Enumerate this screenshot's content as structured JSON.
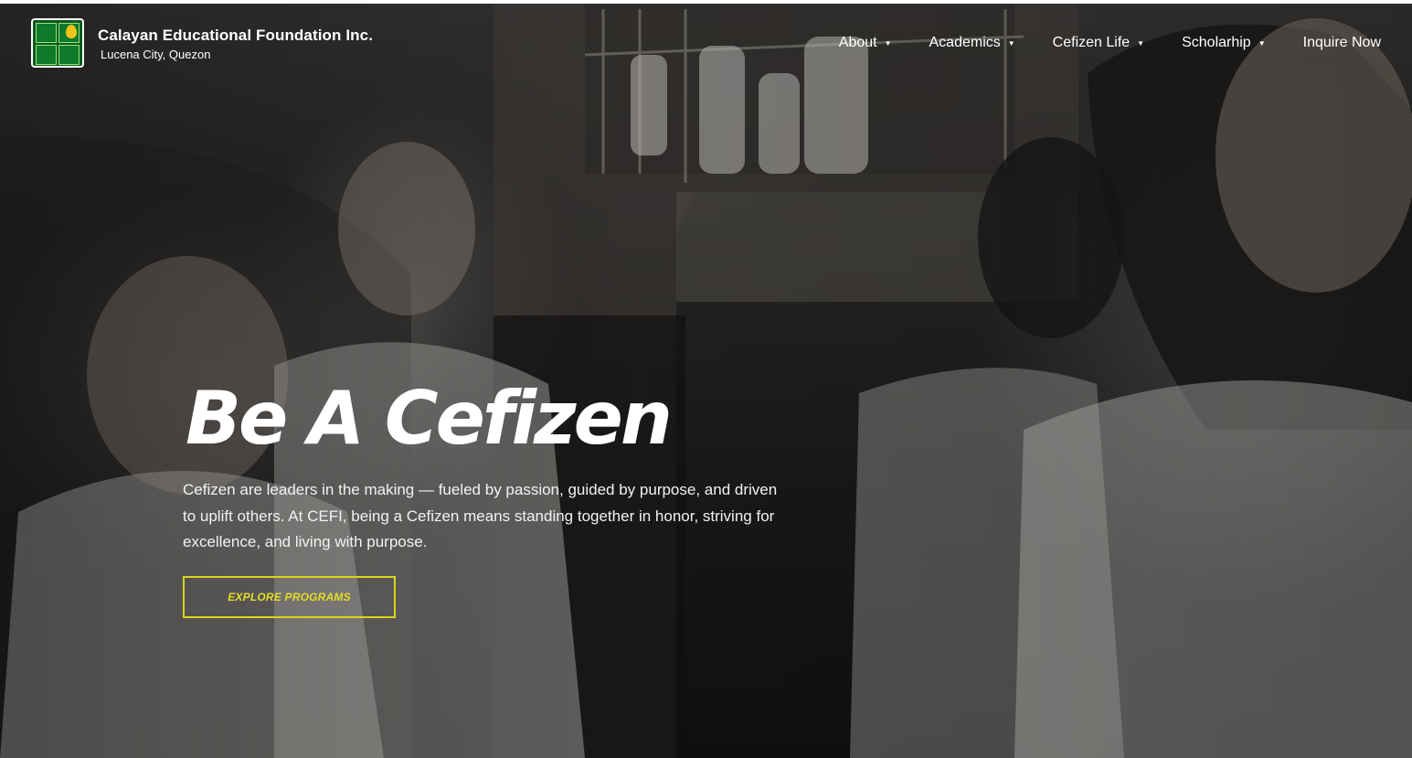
{
  "brand": {
    "name": "Calayan Educational Foundation Inc.",
    "location": "Lucena City, Quezon",
    "logo_icon": "cefi-logo-icon"
  },
  "nav": {
    "items": [
      {
        "label": "About",
        "has_dropdown": true
      },
      {
        "label": "Academics",
        "has_dropdown": true
      },
      {
        "label": "Cefizen Life",
        "has_dropdown": true
      },
      {
        "label": "Scholarhip",
        "has_dropdown": true
      },
      {
        "label": "Inquire Now",
        "has_dropdown": false
      }
    ],
    "caret_glyph": "▼"
  },
  "hero": {
    "headline": "Be A Cefizen",
    "description": "Cefizen are leaders in the making — fueled by passion, guided by purpose, and driven to uplift others. At CEFI, being a Cefizen means standing together in honor, striving for excellence, and living with purpose.",
    "cta_label": "EXPLORE PROGRAMS",
    "cta_color": "#d9d41a",
    "background_image": "students-in-uniform-looking-up-photo"
  }
}
